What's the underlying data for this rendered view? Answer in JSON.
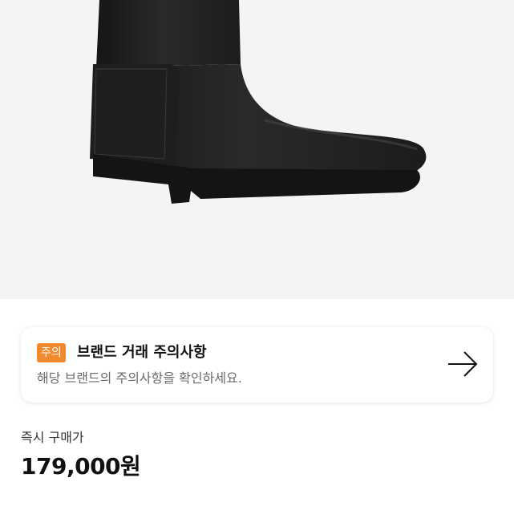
{
  "product": {
    "image_alt": "black rain boot",
    "background_color": "#f4f4f6"
  },
  "notice": {
    "badge": "주의",
    "badge_color": "#f08a2c",
    "title": "브랜드 거래 주의사항",
    "description": "해당 브랜드의 주의사항을 확인하세요.",
    "arrow_icon": "arrow-right-icon"
  },
  "price": {
    "label": "즉시 구매가",
    "value": "179,000원"
  }
}
